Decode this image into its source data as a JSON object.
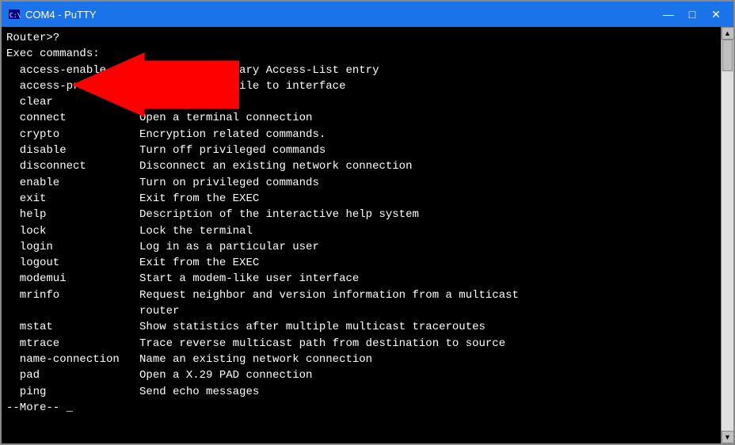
{
  "window": {
    "title": "COM4 - PuTTY",
    "icon": "terminal-icon"
  },
  "titlebar": {
    "minimize_label": "—",
    "maximize_label": "□",
    "close_label": "✕"
  },
  "terminal": {
    "content": "Router>?\nExec commands:\n  access-enable     Create a temporary Access-List entry\n  access-profile    Apply user-profile to interface\n  clear             Reset functions\n  connect           Open a terminal connection\n  crypto            Encryption related commands.\n  disable           Turn off privileged commands\n  disconnect        Disconnect an existing network connection\n  enable            Turn on privileged commands\n  exit              Exit from the EXEC\n  help              Description of the interactive help system\n  lock              Lock the terminal\n  login             Log in as a particular user\n  logout            Exit from the EXEC\n  modemui           Start a modem-like user interface\n  mrinfo            Request neighbor and version information from a multicast\n                    router\n  mstat             Show statistics after multiple multicast traceroutes\n  mtrace            Trace reverse multicast path from destination to source\n  name-connection   Name an existing network connection\n  pad               Open a X.29 PAD connection\n  ping              Send echo messages\n--More-- _"
  }
}
